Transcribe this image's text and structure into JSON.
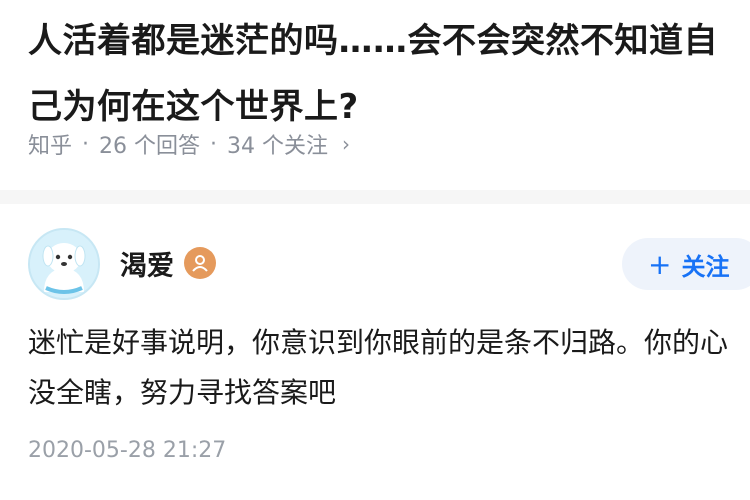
{
  "question": {
    "title": "人活着都是迷茫的吗……会不会突然不知道自己为何在这个世界上?",
    "source": "知乎",
    "sep1": "·",
    "answers_count": "26 个回答",
    "sep2": "·",
    "followers_count": "34 个关注",
    "chevron": "›"
  },
  "answer": {
    "author_name": "渴爱",
    "follow_plus": "+",
    "follow_label": "关注",
    "text": "迷忙是好事说明，你意识到你眼前的是条不归路。你的心没全瞎，努力寻找答案吧",
    "timestamp": "2020-05-28 21:27"
  },
  "colors": {
    "accent": "#1772f6",
    "follow_bg": "#eef3fb",
    "meta_gray": "#8a8f99",
    "badge_orange": "#e59a5c",
    "avatar_bg": "#d8f1fb"
  },
  "icons": {
    "avatar": "cartoon-dog-avatar",
    "badge": "user-badge-icon",
    "chevron": "chevron-right-icon"
  }
}
